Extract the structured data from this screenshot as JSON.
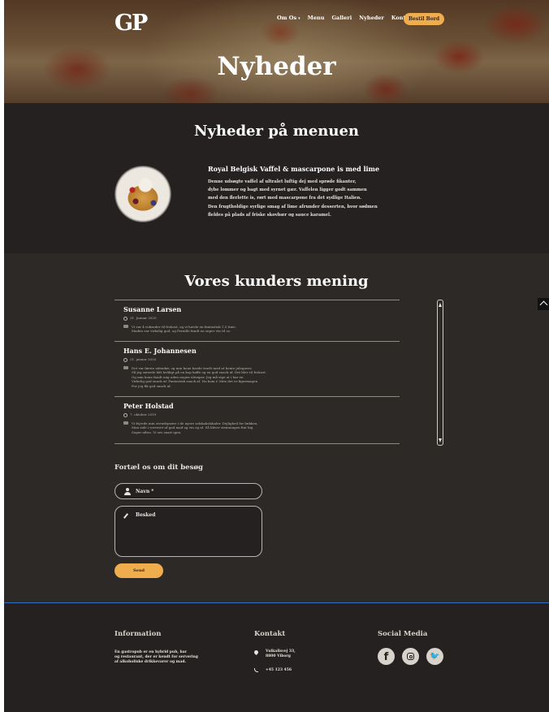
{
  "header": {
    "logo": "GP",
    "nav": [
      "Om Os",
      "Menu",
      "Galleri",
      "Nyheder",
      "Kontakt"
    ],
    "nav_caret": "▾",
    "book_button": "Bestil Bord",
    "title": "Nyheder"
  },
  "menu_news": {
    "title": "Nyheder på menuen",
    "dish_name": "Royal Belgisk Vaffel & mascarpone is med lime",
    "description": [
      "Denne udsøgte vaffel af ultralet luftig dej med sprøde fikanter,",
      "dybe lommer og bagt med syrnet gær. Vaffelen ligger godt sammen",
      "med den flerlette is, rørt med mascarpone fra det sydlige Italien.",
      "Den frugtholdige syrlige smag af lime afrunder desserten, hvor sødmen",
      "fleldes på plads af friske skovbær og sauce karamel."
    ]
  },
  "reviews": {
    "title": "Vores kunders mening",
    "items": [
      {
        "name": "Susanne Larsen",
        "date": "31. Januar 2020",
        "text": [
          "Vi var 4 voksnder til frokost, og vi havde en fantastisk 1,5 time.",
          "Maden var virkelig god, og Pernille fandt en super vin til os."
        ]
      },
      {
        "name": "Hans E. Johannesen",
        "date": "21. januar 2020",
        "text": [
          "Det var første udendør, og min kone havde travlt med at hente julegaver,",
          "Så jeg satsede lidt heldigt på en kop kaffe og en god snack af. Det blev til frokost.",
          "Og min kone fandt mig uden nogen ulemper. Jeg må sige at i har en",
          "Virkelig god snack af. Fantastisk snack af. Nu kom i! Men det er figurmagen",
          "For jeg fik god snack af."
        ]
      },
      {
        "name": "Peter Holstad",
        "date": "7. oktober 2019",
        "text": [
          "Vi fejrede min svendeprøve i de nyere selskabslokaler. Dejlighed for lækken,",
          "Man side i serveret af god mad og vin og øl. Så bliver stemningen fint bøj.",
          "Super aften. Vi ses snart igen."
        ]
      }
    ]
  },
  "form": {
    "title": "Fortæl os om dit besøg",
    "name_placeholder": "Navn *",
    "message_placeholder": "Besked",
    "send_button": "Send"
  },
  "footer": {
    "info_title": "Information",
    "info_text": [
      "En gastropub er en hybrid pub, bar",
      "og restaurant, der er kendt for servering",
      "af alkoholiske drikkevarer og mad."
    ],
    "contact_title": "Kontakt",
    "address": [
      "Vulkallsvej 33,",
      "8800 Viborg"
    ],
    "phone": "+45 123 456",
    "social_title": "Social Media",
    "icons": [
      "facebook-icon",
      "instagram-icon",
      "twitter-icon"
    ]
  },
  "colors": {
    "accent": "#f0ad4e",
    "background": "#242120",
    "section_bg": "#2c2926",
    "footer_rule": "#2f6fbf"
  }
}
